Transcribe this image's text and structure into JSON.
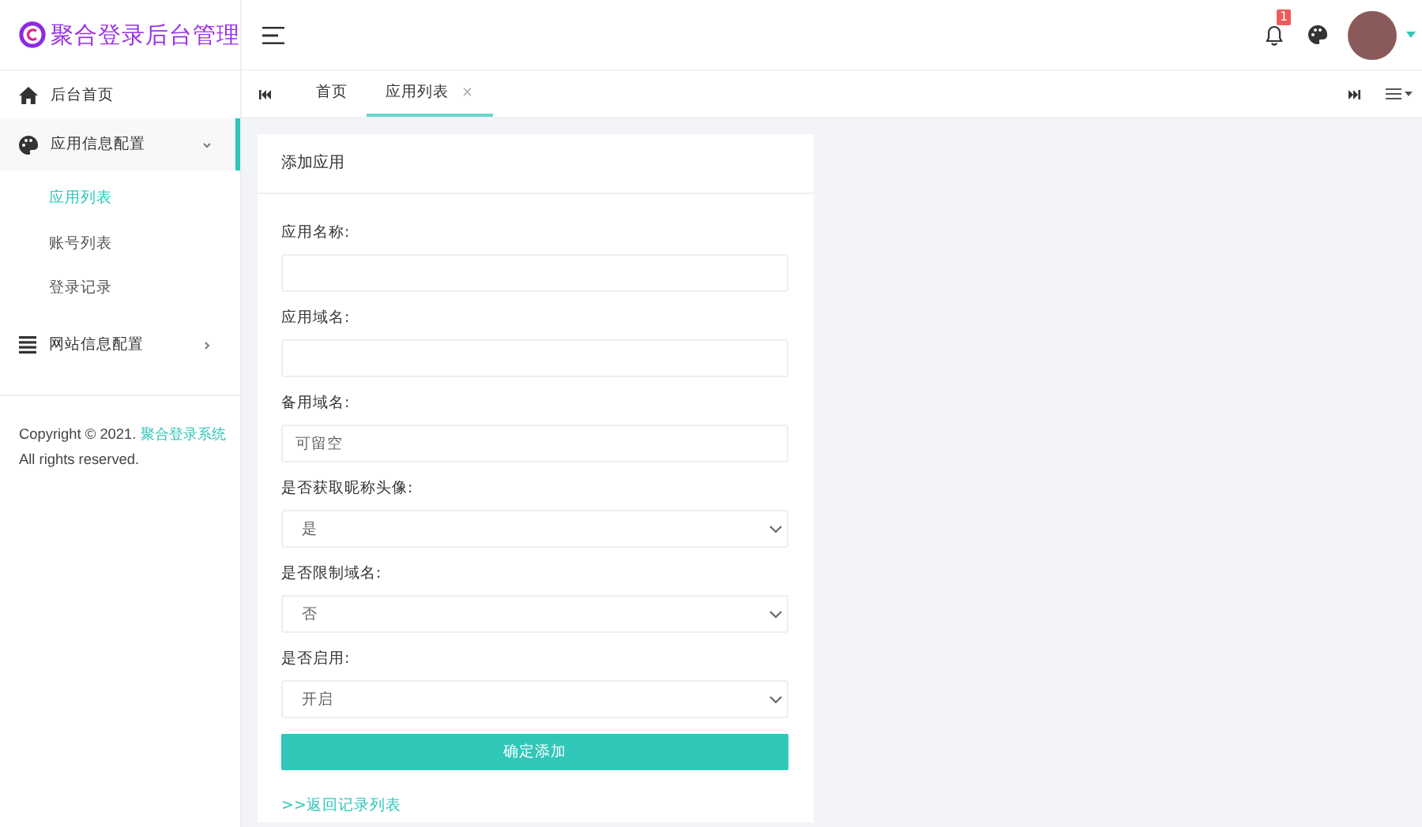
{
  "logo": {
    "title": "聚合登录后台管理"
  },
  "header": {
    "notification_count": "1"
  },
  "sidebar": {
    "items": [
      {
        "label": "后台首页",
        "selected": false
      },
      {
        "label": "应用信息配置",
        "expanded": true,
        "selected": true,
        "children": [
          {
            "label": "应用列表",
            "selected": true
          },
          {
            "label": "账号列表",
            "selected": false
          },
          {
            "label": "登录记录",
            "selected": false
          }
        ]
      },
      {
        "label": "网站信息配置",
        "expanded": false,
        "selected": false
      }
    ],
    "footer": {
      "text": "Copyright © 2021. ",
      "link": "聚合登录系统",
      "suffix": " All rights reserved."
    }
  },
  "tabs": [
    {
      "label": "首页",
      "selected": false
    },
    {
      "label": "应用列表",
      "selected": true,
      "close": "×"
    }
  ],
  "form": {
    "title": "添加应用",
    "fields": [
      {
        "kind": "input",
        "label": "应用名称:"
      },
      {
        "kind": "input",
        "label": "应用域名:"
      },
      {
        "kind": "input",
        "label": "备用域名:",
        "placeholder": "可留空"
      },
      {
        "kind": "select",
        "label": "是否获取昵称头像:",
        "value": "是"
      },
      {
        "kind": "select",
        "label": "是否限制域名:",
        "value": "否"
      },
      {
        "kind": "select",
        "label": "是否启用:",
        "value": "开启"
      }
    ],
    "submit": "确定添加",
    "back_link": ">>返回记录列表"
  }
}
